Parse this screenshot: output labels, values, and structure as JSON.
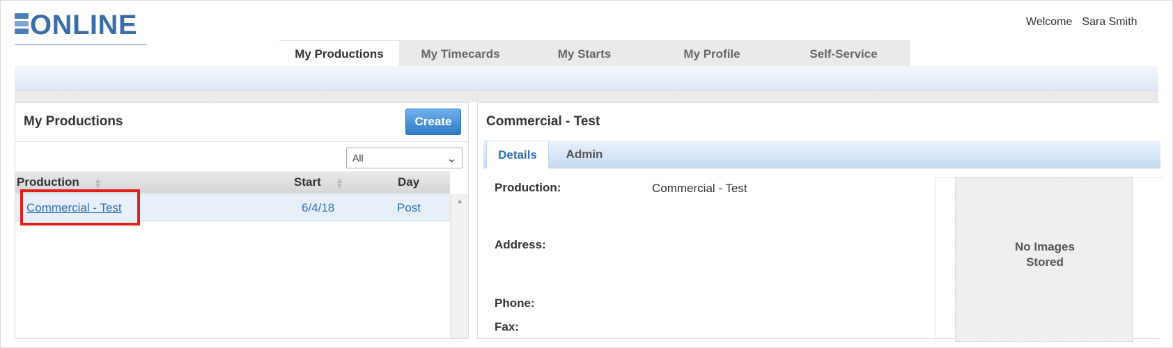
{
  "header": {
    "logo_text": "ONLINE",
    "welcome_label": "Welcome",
    "user_name": "Sara Smith"
  },
  "topnav": {
    "tabs": [
      {
        "label": "My Productions",
        "active": true
      },
      {
        "label": "My Timecards",
        "active": false
      },
      {
        "label": "My Starts",
        "active": false
      },
      {
        "label": "My Profile",
        "active": false
      },
      {
        "label": "Self-Service",
        "active": false
      }
    ]
  },
  "left_panel": {
    "title": "My Productions",
    "create_label": "Create",
    "filter": {
      "selected": "All"
    },
    "columns": [
      "Production",
      "Start",
      "Day"
    ],
    "rows": [
      {
        "production": "Commercial - Test",
        "start": "6/4/18",
        "day": "Post"
      }
    ]
  },
  "right_panel": {
    "title": "Commercial - Test",
    "tabs": [
      "Details",
      "Admin"
    ],
    "active_tab": "Details",
    "fields": {
      "production_label": "Production:",
      "production_value": "Commercial - Test",
      "address_label": "Address:",
      "phone_label": "Phone:",
      "fax_label": "Fax:"
    },
    "images_placeholder_line1": "No Images",
    "images_placeholder_line2": "Stored"
  },
  "colors": {
    "brand_blue": "#3a6ea8",
    "link_blue": "#2f6fb5",
    "create_button": "#2f7bc6",
    "highlight_red": "#e0201b",
    "selected_row": "#e6effa"
  },
  "icons": {
    "sort": "sort-arrows-icon",
    "dropdown": "chevron-down-icon",
    "scroll_up": "scroll-up-arrow-icon",
    "logo": "logo-mark-icon"
  }
}
